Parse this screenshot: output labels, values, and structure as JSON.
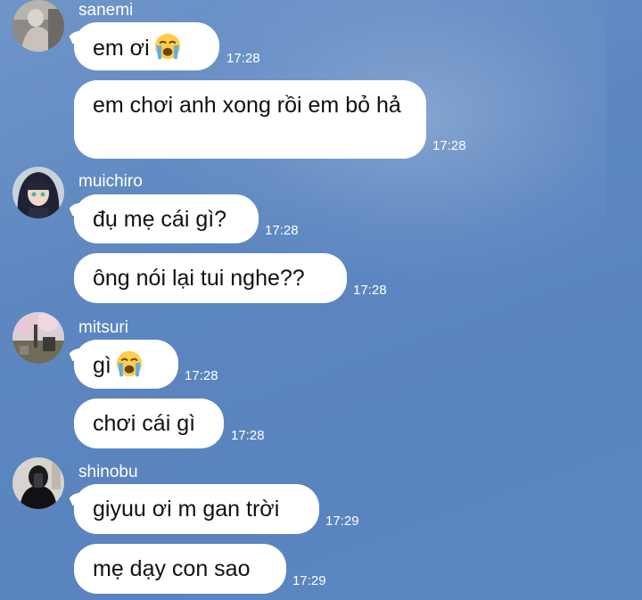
{
  "messages": [
    {
      "sender": "sanemi",
      "bubbles": [
        {
          "text": "em ơi",
          "emoji": "loudly-crying-face",
          "time": "17:28"
        },
        {
          "text": "em chơi anh xong rồi em bỏ hả",
          "time": "17:28"
        }
      ]
    },
    {
      "sender": "muichiro",
      "bubbles": [
        {
          "text": "đụ mẹ cái gì?",
          "time": "17:28"
        },
        {
          "text": "ông nói lại tui nghe??",
          "time": "17:28"
        }
      ]
    },
    {
      "sender": "mitsuri",
      "bubbles": [
        {
          "text": "gì",
          "emoji": "loudly-crying-face",
          "time": "17:28"
        },
        {
          "text": "chơi cái gì",
          "time": "17:28"
        }
      ]
    },
    {
      "sender": "shinobu",
      "bubbles": [
        {
          "text": "giyuu ơi m gan trời",
          "time": "17:29"
        },
        {
          "text": "mẹ dạy con sao",
          "time": "17:29"
        }
      ]
    }
  ],
  "colors": {
    "background": "#5d86c0",
    "bubble": "#ffffff",
    "text": "#111111",
    "meta_text": "#ffffff"
  }
}
